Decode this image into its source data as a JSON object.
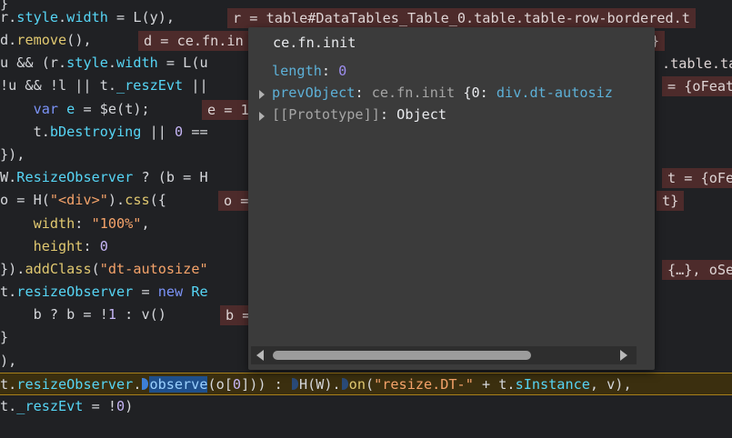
{
  "code_lines": [
    "}",
    "r.style.width = L(y),",
    "d.remove(),",
    "u && (r.style.width = L(u",
    "!u && !l || t._reszEvt ||",
    "    var e = $e(t);",
    "    t.bDestroying || 0 ==",
    "}),",
    "W.ResizeObserver ? (b = H",
    "o = H(\"<div>\").css({",
    "    width: \"100%\",",
    "    height: 0",
    "}).addClass(\"dt-autosize\"",
    "t.resizeObserver = new Re",
    "    b ? b = !1 : v()",
    "}",
    "),",
    "t.resizeObserver.observe(o[0])) : H(W).on(\"resize.DT-\" + t.sInstance, v),",
    "t._reszEvt = !0)"
  ],
  "annotations": [
    "r = table#DataTables_Table_0.table.table-row-bordered.t",
    "d = ce.fn.in",
    "}",
    ".table.ta",
    "= {oFeat",
    "e = 1",
    "t = {oFe",
    "o =",
    "t}",
    "{…}, oSe",
    "b ="
  ],
  "popover": {
    "title": "ce.fn.init",
    "length_key": "length",
    "length_value": "0",
    "prev_key": "prevObject",
    "prev_type": "ce.fn.init",
    "prev_open": "{0: ",
    "prev_value": "div.dt-autosiz",
    "proto_key": "[[Prototype]]",
    "proto_value": "Object"
  }
}
